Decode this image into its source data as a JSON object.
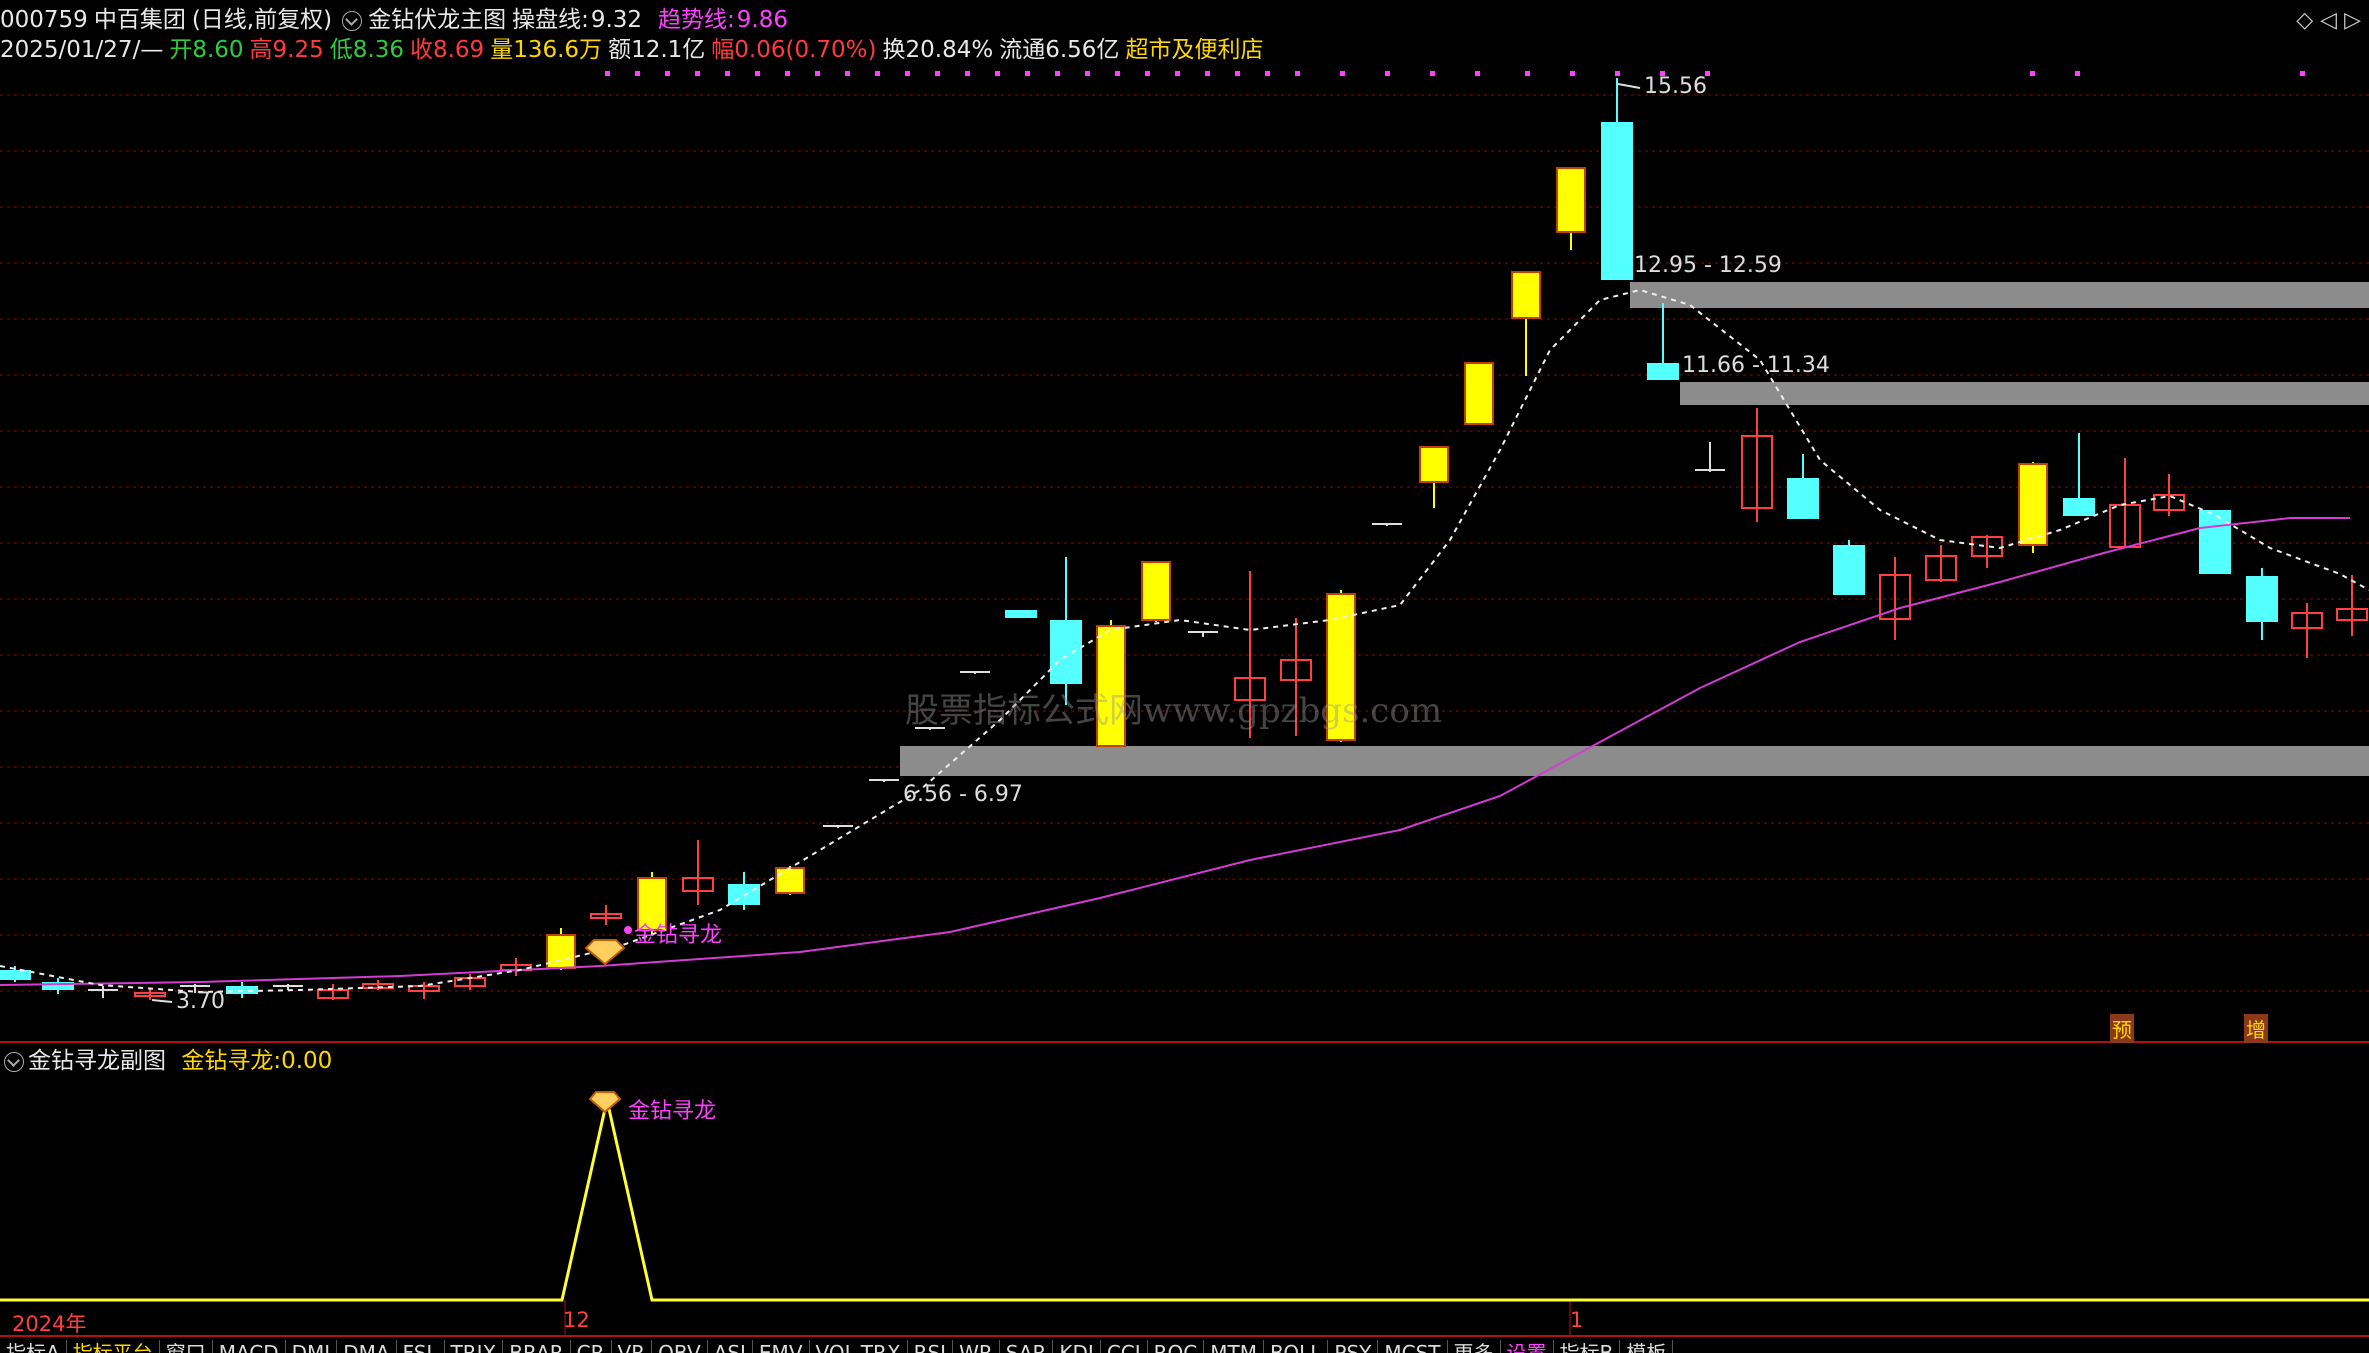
{
  "header": {
    "code": "000759",
    "name": "中百集团",
    "period": "(日线,前复权)",
    "indicator": "金钻伏龙主图",
    "line1_label": "操盘线:",
    "line1_value": "9.32",
    "line2_label": "趋势线:",
    "line2_value": "9.86",
    "date": "2025/01/27/—",
    "open_label": "开",
    "open": "8.60",
    "high_label": "高",
    "high": "9.25",
    "low_label": "低",
    "low": "8.36",
    "close_label": "收",
    "close": "8.69",
    "vol_label": "量",
    "vol": "136.6万",
    "amt_label": "额",
    "amt": "12.1亿",
    "chg_label": "幅",
    "chg": "0.06(0.70%)",
    "turnover": "换20.84%",
    "float": "流通6.56亿",
    "sector": "超市及便利店"
  },
  "main_chart": {
    "price_labels": {
      "high": "15.56",
      "low": "3.70",
      "zone1": "12.95 - 12.59",
      "zone2": "11.66 - 11.34",
      "zone3": "6.56 - 6.97"
    },
    "signal": "金钻寻龙",
    "badge_pre": "预",
    "badge_add": "增",
    "watermark": "股票指标公式网www.gpzbgs.com",
    "colors": {
      "up": "#ffff00",
      "down": "#54ffff",
      "red": "#ff4040",
      "ma": "#d23cd2",
      "zone": "#8c8c8c"
    }
  },
  "sub_chart": {
    "title": "金钻寻龙副图",
    "value_label": "金钻寻龙:",
    "value": "0.00",
    "signal": "金钻寻龙",
    "x_labels": [
      "2024年",
      "12",
      "1"
    ]
  },
  "bottom_tabs": [
    "指标A",
    "指标平台",
    "窗口",
    "MACD",
    "DMI",
    "DMA",
    "FSL",
    "TRIX",
    "BRAR",
    "CR",
    "VR",
    "OBV",
    "ASI",
    "EMV",
    "VOL-TRX",
    "RSI",
    "WR",
    "SAR",
    "KDJ",
    "CCI",
    "ROC",
    "MTM",
    "BOLL",
    "PSY",
    "MCST",
    "更多",
    "设置",
    "指标B",
    "模板"
  ]
}
